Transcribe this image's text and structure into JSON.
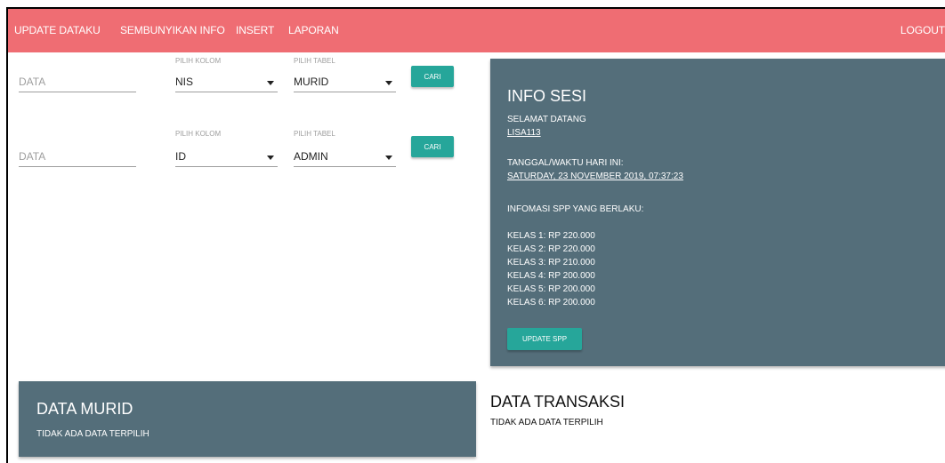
{
  "navbar": {
    "update_dataku": "UPDATE DATAKU",
    "sembunyikan_info": "SEMBUNYIKAN INFO",
    "insert": "INSERT",
    "laporan": "LAPORAN",
    "logout": "LOGOUT"
  },
  "search1": {
    "data_placeholder": "DATA",
    "kolom_label": "PILIH KOLOM",
    "kolom_value": "NIS",
    "tabel_label": "PILIH TABEL",
    "tabel_value": "MURID",
    "button": "CARI"
  },
  "search2": {
    "data_placeholder": "DATA",
    "kolom_label": "PILIH KOLOM",
    "kolom_value": "ID",
    "tabel_label": "PILIH TABEL",
    "tabel_value": "ADMIN",
    "button": "CARI"
  },
  "info_sesi": {
    "title": "INFO SESI",
    "welcome": "SELAMAT DATANG",
    "username": "LISA113",
    "datetime_label": "TANGGAL/WAKTU HARI INI:",
    "datetime_value": "SATURDAY, 23 NOVEMBER 2019, 07:37:23",
    "spp_label": "INFOMASI SPP YANG BERLAKU:",
    "spp_rows": [
      "KELAS 1: RP 220.000",
      "KELAS 2: RP 220.000",
      "KELAS 3: RP 210.000",
      "KELAS 4: RP 200.000",
      "KELAS 5: RP 200.000",
      "KELAS 6: RP 200.000"
    ],
    "update_button": "UPDATE SPP"
  },
  "data_murid": {
    "title": "DATA MURID",
    "message": "TIDAK ADA DATA TERPILIH"
  },
  "data_transaksi": {
    "title": "DATA TRANSAKSI",
    "message": "TIDAK ADA DATA TERPILIH"
  },
  "colors": {
    "navbar": "#ef6d73",
    "card": "#546e7a",
    "button": "#26a69a"
  }
}
